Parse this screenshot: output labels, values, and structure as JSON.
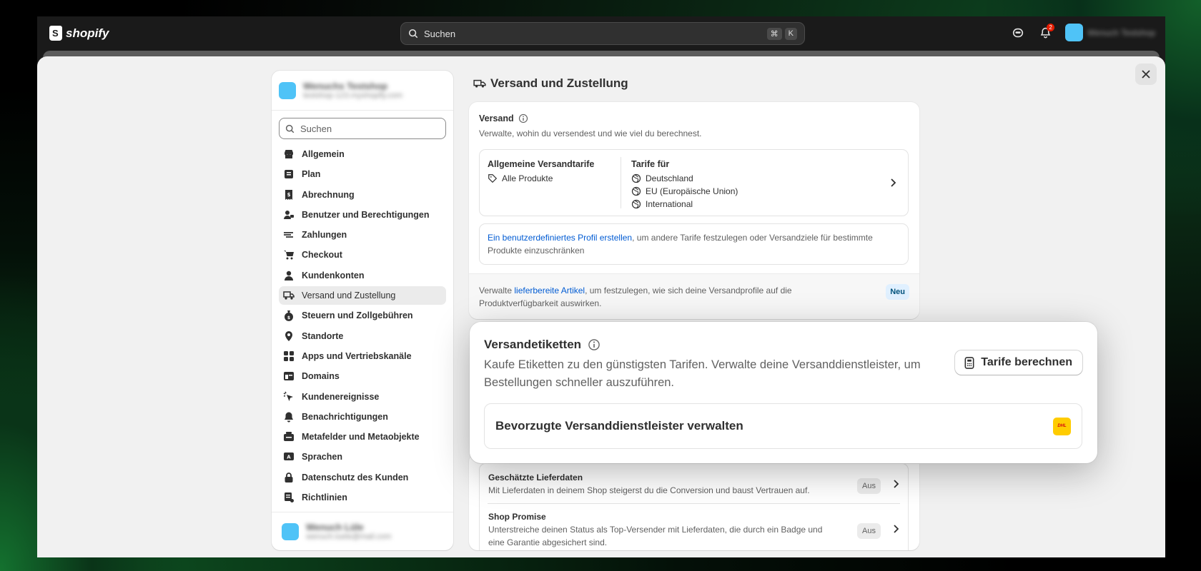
{
  "topbar": {
    "logo_text": "shopify",
    "search_placeholder": "Suchen",
    "shortcut_key1": "⌘",
    "shortcut_key2": "K",
    "notification_count": "2",
    "user_name": "Wenuch Testshop"
  },
  "sidebar": {
    "store_name": "Wenuchs Testshop",
    "store_email": "testshop-123.myshopify.com",
    "search_placeholder": "Suchen",
    "items": [
      {
        "label": "Allgemein",
        "icon": "store-icon"
      },
      {
        "label": "Plan",
        "icon": "plan-icon"
      },
      {
        "label": "Abrechnung",
        "icon": "receipt-icon"
      },
      {
        "label": "Benutzer und Berechtigungen",
        "icon": "users-icon"
      },
      {
        "label": "Zahlungen",
        "icon": "payments-icon"
      },
      {
        "label": "Checkout",
        "icon": "cart-icon"
      },
      {
        "label": "Kundenkonten",
        "icon": "person-icon"
      },
      {
        "label": "Versand und Zustellung",
        "icon": "truck-icon"
      },
      {
        "label": "Steuern und Zollgebühren",
        "icon": "taxes-icon"
      },
      {
        "label": "Standorte",
        "icon": "location-icon"
      },
      {
        "label": "Apps und Vertriebskanäle",
        "icon": "apps-icon"
      },
      {
        "label": "Domains",
        "icon": "domains-icon"
      },
      {
        "label": "Kundenereignisse",
        "icon": "cursor-icon"
      },
      {
        "label": "Benachrichtigungen",
        "icon": "bell-icon"
      },
      {
        "label": "Metafelder und Metaobjekte",
        "icon": "metafields-icon"
      },
      {
        "label": "Sprachen",
        "icon": "language-icon"
      },
      {
        "label": "Datenschutz des Kunden",
        "icon": "lock-icon"
      },
      {
        "label": "Richtlinien",
        "icon": "policy-icon"
      }
    ],
    "active_index": 7,
    "footer_name": "Wenuch Lüle",
    "footer_email": "wenuch.luele@mail.com"
  },
  "main": {
    "page_title": "Versand und Zustellung",
    "versand": {
      "title": "Versand",
      "subtitle": "Verwalte, wohin du versendest und wie viel du berechnest.",
      "general_rates_title": "Allgemeine Versandtarife",
      "general_rates_products": "Alle Produkte",
      "rates_for_title": "Tarife für",
      "zones": [
        "Deutschland",
        "EU (Europäische Union)",
        "International"
      ],
      "custom_profile_link": "Ein benutzerdefiniertes Profil erstellen",
      "custom_profile_text": ", um andere Tarife festzulegen oder Versandziele für bestimmte Produkte einzuschränken",
      "ready_prefix": "Verwalte ",
      "ready_link": "lieferbereite Artikel",
      "ready_suffix": ", um festzulegen, wie sich deine Versandprofile auf die Produktverfügbarkeit auswirken.",
      "new_badge": "Neu"
    },
    "delivery_rows": [
      {
        "title": "Geschätzte Lieferdaten",
        "text": "Mit Lieferdaten in deinem Shop steigerst du die Conversion und baust Vertrauen auf.",
        "status": "Aus"
      },
      {
        "title": "Shop Promise",
        "text": "Unterstreiche deinen Status als Top-Versender mit Lieferdaten, die durch ein Badge und eine Garantie abgesichert sind.",
        "status": "Aus"
      }
    ]
  },
  "popup": {
    "title": "Versandetiketten",
    "subtitle": "Kaufe Etiketten zu den günstigsten Tarifen. Verwalte deine Versanddienstleister, um Bestellungen schneller auszuführen.",
    "button_label": "Tarife berechnen",
    "carrier_row": "Bevorzugte Versanddienstleister verwalten",
    "carrier_logo": "DHL"
  },
  "colors": {
    "accent_link": "#005bd3",
    "dhl_yellow": "#ffcc00",
    "dhl_red": "#d40511",
    "badge_new_bg": "#e0f0ff"
  }
}
